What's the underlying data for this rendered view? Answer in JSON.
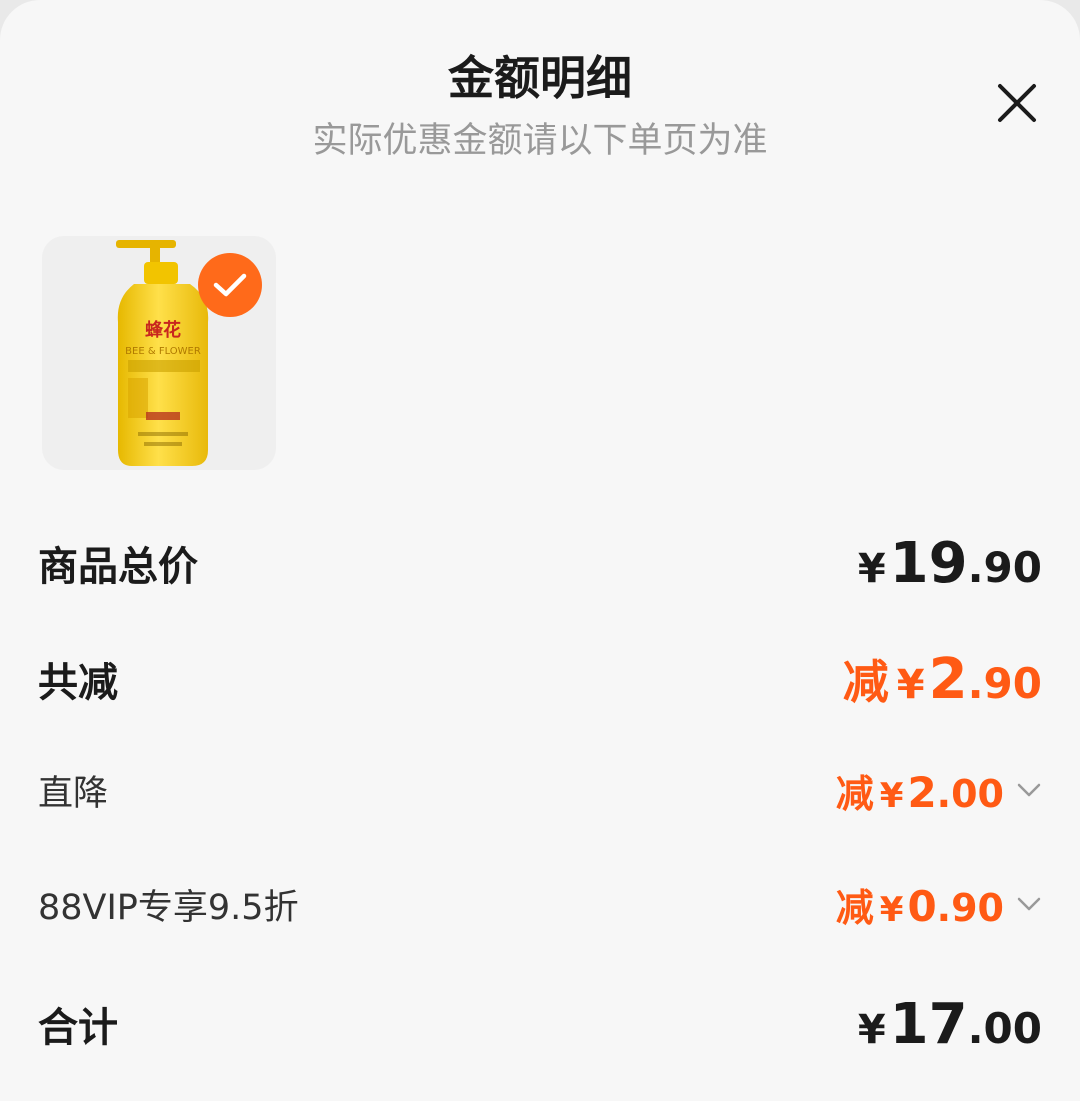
{
  "header": {
    "title": "金额明细",
    "subtitle": "实际优惠金额请以下单页为准"
  },
  "product": {
    "brand_cn": "蜂花",
    "brand_en": "BEE & FLOWER",
    "selected": true
  },
  "rows": {
    "total": {
      "label": "商品总价",
      "yen": "¥",
      "int": "19",
      "dec": ".90"
    },
    "discount": {
      "label": "共减",
      "prefix": "减",
      "yen": "¥",
      "int": "2",
      "dec": ".90"
    },
    "direct": {
      "label": "直降",
      "prefix": "减",
      "yen": "¥",
      "int": "2",
      "dec": ".00"
    },
    "vip": {
      "label": "88VIP专享9.5折",
      "prefix": "减",
      "yen": "¥",
      "int": "0",
      "dec": ".90"
    },
    "sum": {
      "label": "合计",
      "yen": "¥",
      "int": "17",
      "dec": ".00"
    }
  },
  "colors": {
    "accent": "#ff5a14",
    "badge": "#ff6a1a",
    "muted": "#999999"
  }
}
